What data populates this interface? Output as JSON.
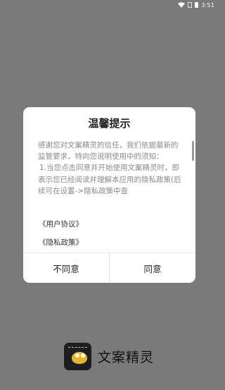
{
  "status": {
    "time": "3:51"
  },
  "dialog": {
    "title": "温馨提示",
    "paragraph1": "感谢您对文案精灵的信任，我们依据最新的监管要求，特向您说明使用中的须知：",
    "paragraph2": "1.当您点击同意并开始使用文案精灵时，即表示您已经阅读并理解本应用的隐私政策(后续可在设置->隐私政策中查",
    "user_agreement_link": "《用户协议》",
    "privacy_policy_link": "《隐私政策》",
    "disagree_label": "不同意",
    "agree_label": "同意"
  },
  "brand": {
    "name": "文案精灵"
  }
}
